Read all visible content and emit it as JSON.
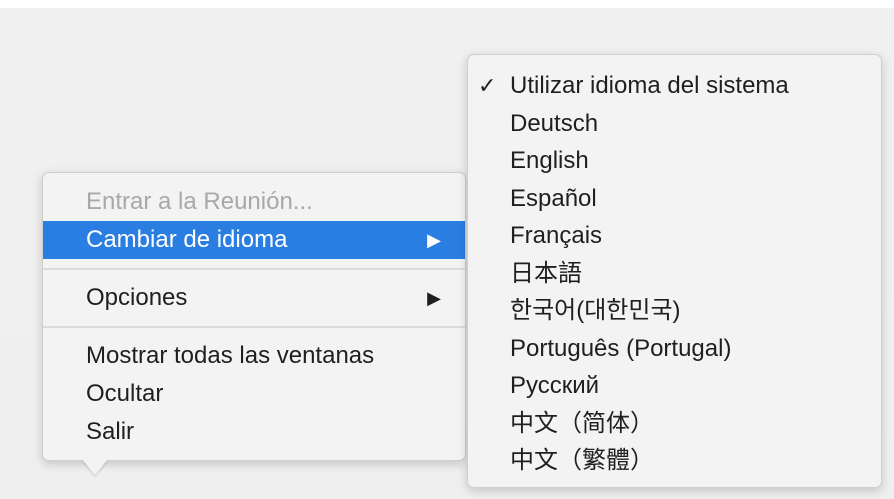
{
  "main_menu": {
    "items": [
      {
        "label": "Entrar a la Reunión...",
        "state": "disabled"
      },
      {
        "label": "Cambiar de idioma",
        "state": "selected",
        "submenu_arrow": "▶"
      },
      {
        "label": "Opciones",
        "state": "normal",
        "submenu_arrow": "▶"
      },
      {
        "label": "Mostrar todas las ventanas",
        "state": "normal"
      },
      {
        "label": "Ocultar",
        "state": "normal"
      },
      {
        "label": "Salir",
        "state": "normal"
      }
    ]
  },
  "language_submenu": {
    "checkmark": "✓",
    "items": [
      {
        "label": "Utilizar idioma del sistema",
        "checked": true
      },
      {
        "label": "Deutsch"
      },
      {
        "label": "English"
      },
      {
        "label": "Español"
      },
      {
        "label": "Français"
      },
      {
        "label": "日本語"
      },
      {
        "label": "한국어(대한민국)"
      },
      {
        "label": "Português (Portugal)"
      },
      {
        "label": "Русский"
      },
      {
        "label": "中文（简体）"
      },
      {
        "label": "中文（繁體）"
      }
    ]
  },
  "colors": {
    "selection": "#2a7de1",
    "menu_background": "#f3f3f3",
    "disabled_text": "#a8a8a8"
  }
}
